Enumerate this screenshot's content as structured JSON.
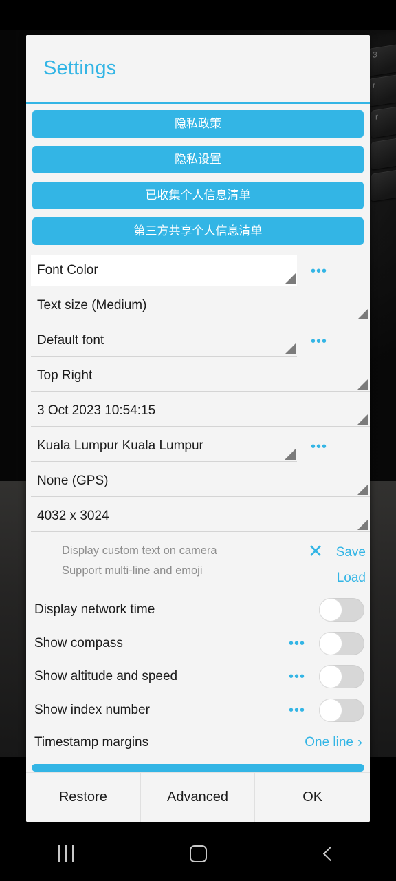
{
  "dialog": {
    "title": "Settings",
    "privacy_buttons": [
      {
        "label": "隐私政策"
      },
      {
        "label": "隐私设置"
      },
      {
        "label": "已收集个人信息清单"
      },
      {
        "label": "第三方共享个人信息清单"
      }
    ],
    "spinner_rows": [
      {
        "value": "Font Color",
        "has_dots": true,
        "dots": "•••",
        "pressed": true
      },
      {
        "value": "Text size (Medium)",
        "has_dots": false,
        "dots": "",
        "pressed": false
      },
      {
        "value": "Default font",
        "has_dots": true,
        "dots": "•••",
        "pressed": false
      },
      {
        "value": "Top Right",
        "has_dots": false,
        "dots": "",
        "pressed": false
      },
      {
        "value": "3 Oct 2023 10:54:15",
        "has_dots": false,
        "dots": "",
        "pressed": false
      },
      {
        "value": "Kuala Lumpur Kuala Lumpur",
        "has_dots": true,
        "dots": "•••",
        "pressed": false
      },
      {
        "value": "None (GPS)",
        "has_dots": false,
        "dots": "",
        "pressed": false
      },
      {
        "value": "4032 x 3024",
        "has_dots": false,
        "dots": "",
        "pressed": false
      }
    ],
    "custom_text": {
      "value": "",
      "placeholder_line1": "Display custom text on camera",
      "placeholder_line2": "Support multi-line and emoji",
      "clear_icon": "✕",
      "save_label": "Save",
      "load_label": "Load"
    },
    "toggle_rows": [
      {
        "label": "Display network time",
        "has_dots": false,
        "dots": "",
        "checked": false
      },
      {
        "label": "Show compass",
        "has_dots": true,
        "dots": "•••",
        "checked": false
      },
      {
        "label": "Show altitude and speed",
        "has_dots": true,
        "dots": "•••",
        "checked": false
      },
      {
        "label": "Show index number",
        "has_dots": true,
        "dots": "•••",
        "checked": false
      }
    ],
    "chevron_row": {
      "label": "Timestamp margins",
      "value": "One line",
      "chevron": "›"
    },
    "footer_buttons": [
      {
        "label": "Restore"
      },
      {
        "label": "Advanced"
      },
      {
        "label": "OK"
      }
    ]
  },
  "background": {
    "key_labels": [
      "3",
      "r",
      "r",
      "",
      ""
    ]
  },
  "navbar": {
    "recents_label": "recents",
    "home_label": "home",
    "back_label": "back"
  },
  "colors": {
    "accent": "#33b5e5",
    "dialog_bg": "#f4f4f4",
    "text": "#1b1b1b",
    "placeholder": "#8d8d8d",
    "switch_track": "#d7d7d7"
  }
}
